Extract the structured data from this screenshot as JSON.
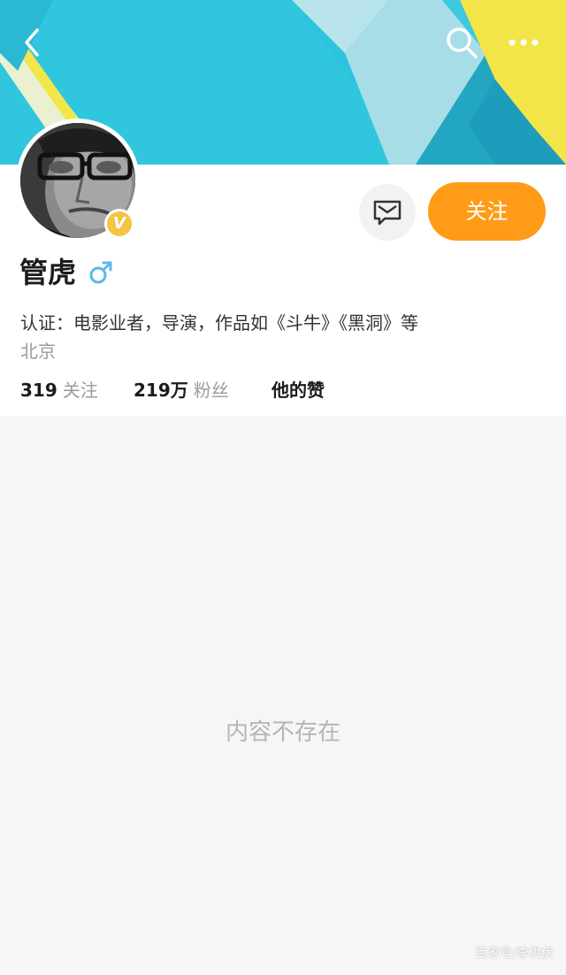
{
  "header": {
    "icons": [
      "back-icon",
      "search-icon",
      "more-icon"
    ],
    "banner_colors": [
      "#29c1da",
      "#f4e54a",
      "#1ea2c0"
    ]
  },
  "profile": {
    "name": "管虎",
    "gender_symbol": "♂",
    "verified_badge": "V",
    "certification": "认证：电影业者，导演，作品如《斗牛》《黑洞》等",
    "location": "北京",
    "message_icon": "message-icon",
    "follow_label": "关注"
  },
  "stats": {
    "following_count": "319",
    "following_label": "关注",
    "fans_count": "219万",
    "fans_label": "粉丝",
    "likes_label": "他的赞"
  },
  "content": {
    "empty_text": "内容不存在"
  },
  "watermark": "百家号/李洪伏",
  "colors": {
    "accent": "#ff9b16",
    "verified": "#f6c342",
    "gender": "#5bb8e8"
  }
}
